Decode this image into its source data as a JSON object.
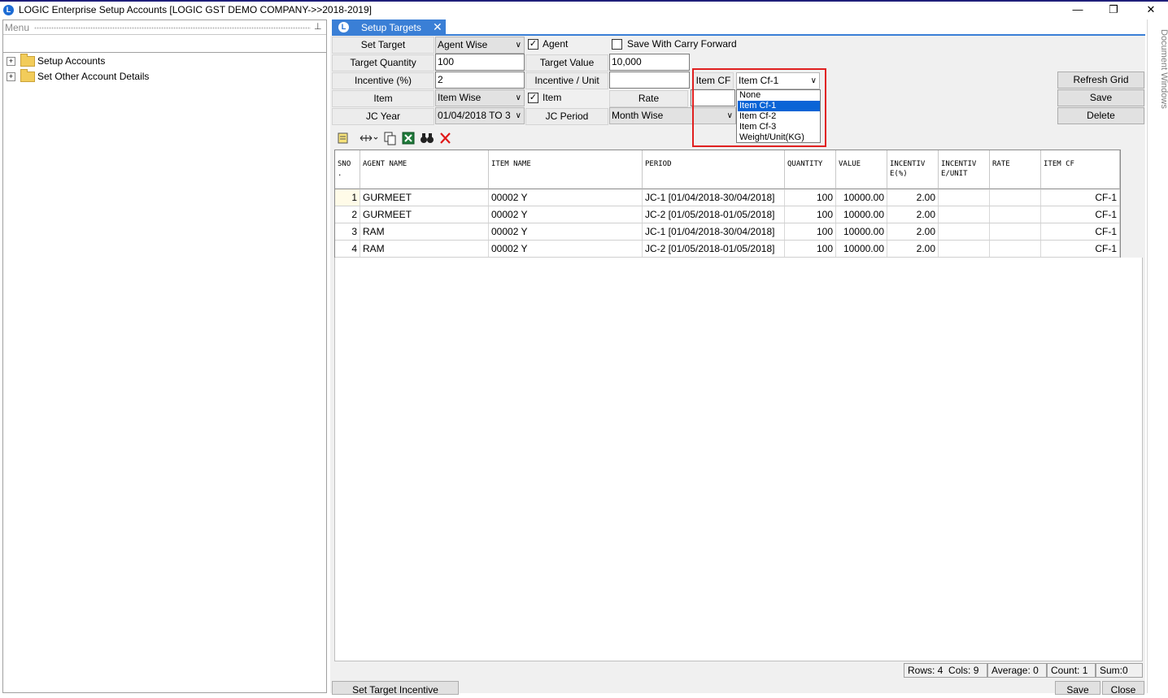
{
  "window": {
    "title": "LOGIC Enterprise Setup Accounts  [LOGIC GST DEMO COMPANY->>2018-2019]",
    "minimize": "—",
    "maximize": "❐",
    "close": "✕"
  },
  "menu": {
    "title": "Menu",
    "pin": "⊥",
    "items": [
      {
        "label": "Setup Accounts"
      },
      {
        "label": "Set Other Account Details"
      }
    ]
  },
  "tab": {
    "label": "Setup Targets",
    "close": "✕"
  },
  "side_panel": {
    "label": "Document Windows"
  },
  "form": {
    "set_target_label": "Set Target",
    "set_target_value": "Agent Wise",
    "agent_label": "Agent",
    "agent_checked": true,
    "save_carry_label": "Save With Carry Forward",
    "save_carry_checked": false,
    "target_quantity_label": "Target Quantity",
    "target_quantity_value": "100",
    "target_value_label": "Target Value",
    "target_value_value": "10,000",
    "incentive_pct_label": "Incentive (%)",
    "incentive_pct_value": "2",
    "incentive_unit_label": "Incentive / Unit",
    "incentive_unit_value": "",
    "item_cf_label": "Item CF",
    "item_cf_value": "Item Cf-1",
    "item_cf_options": [
      "None",
      "Item Cf-1",
      "Item Cf-2",
      "Item Cf-3",
      "Weight/Unit(KG)"
    ],
    "item_cf_selected_index": 1,
    "item_label": "Item",
    "item_value": "Item Wise",
    "item_check_label": "Item",
    "item_checked": true,
    "rate_label": "Rate",
    "rate_value": "",
    "jc_year_label": "JC Year",
    "jc_year_value": "01/04/2018 TO 3",
    "jc_period_label": "JC Period",
    "jc_period_value": "Month Wise"
  },
  "buttons": {
    "refresh_grid": "Refresh Grid",
    "save": "Save",
    "delete": "Delete",
    "set_target_incentive": "Set Target Incentive",
    "bottom_save": "Save",
    "bottom_close": "Close"
  },
  "toolbar_icons": [
    "notes-icon",
    "column-resize-icon",
    "copy-icon",
    "excel-icon",
    "find-icon",
    "delete-icon"
  ],
  "grid": {
    "headers": [
      "SNO\n.",
      "AGENT NAME",
      "ITEM NAME",
      "PERIOD",
      "QUANTITY",
      "VALUE",
      "INCENTIV\nE(%)",
      "INCENTIV\nE/UNIT",
      "RATE",
      "ITEM CF"
    ],
    "rows": [
      [
        "1",
        "GURMEET",
        "00002 Y",
        "JC-1 [01/04/2018-30/04/2018]",
        "100",
        "10000.00",
        "2.00",
        "",
        "",
        "CF-1"
      ],
      [
        "2",
        "GURMEET",
        "00002 Y",
        "JC-2 [01/05/2018-01/05/2018]",
        "100",
        "10000.00",
        "2.00",
        "",
        "",
        "CF-1"
      ],
      [
        "3",
        "RAM",
        "00002 Y",
        "JC-1 [01/04/2018-30/04/2018]",
        "100",
        "10000.00",
        "2.00",
        "",
        "",
        "CF-1"
      ],
      [
        "4",
        "RAM",
        "00002 Y",
        "JC-2 [01/05/2018-01/05/2018]",
        "100",
        "10000.00",
        "2.00",
        "",
        "",
        "CF-1"
      ]
    ]
  },
  "status": {
    "rows": "Rows: 4",
    "cols": "Cols: 9",
    "average": "Average: 0",
    "count": "Count: 1",
    "sum": "Sum:0"
  }
}
